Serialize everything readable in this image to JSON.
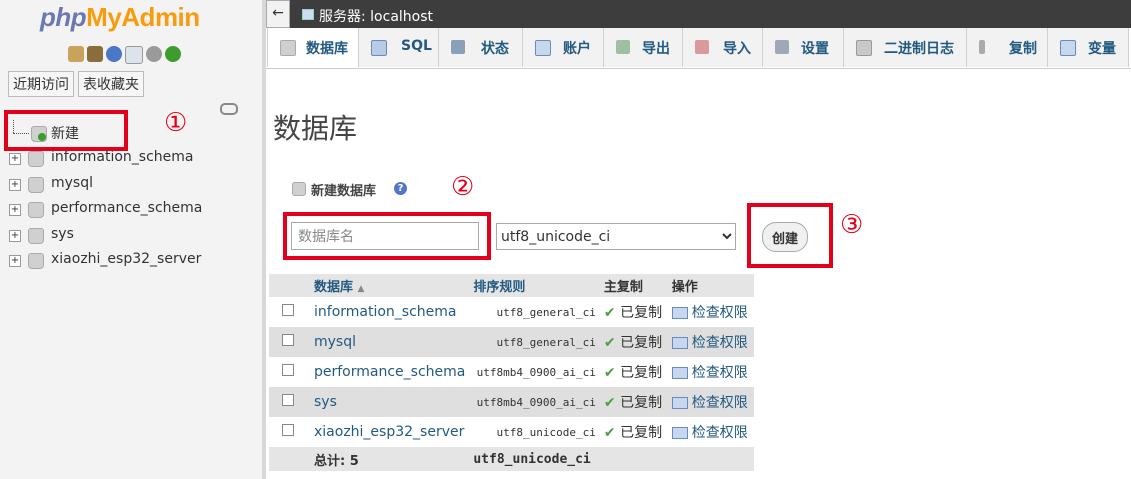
{
  "logo": {
    "php": "php",
    "my": "My",
    "admin": "Admin"
  },
  "sidebar": {
    "recent_tab": "近期访问",
    "favorites_tab": "表收藏夹",
    "new_label": "新建",
    "databases": [
      "information_schema",
      "mysql",
      "performance_schema",
      "sys",
      "xiaozhi_esp32_server"
    ]
  },
  "topbar": {
    "back": "←",
    "server": "服务器: localhost"
  },
  "tabs": [
    "数据库",
    "SQL",
    "状态",
    "账户",
    "导出",
    "导入",
    "设置",
    "二进制日志",
    "复制",
    "变量"
  ],
  "page_title": "数据库",
  "create": {
    "label": "新建数据库",
    "help": "?",
    "placeholder": "数据库名",
    "collation": "utf8_unicode_ci",
    "button": "创建"
  },
  "annotations": {
    "one": "①",
    "two": "②",
    "three": "③"
  },
  "table": {
    "headers": [
      "数据库",
      "排序规则",
      "主复制",
      "操作"
    ],
    "rows": [
      {
        "name": "information_schema",
        "collation": "utf8_general_ci",
        "replication": "已复制",
        "action": "检查权限"
      },
      {
        "name": "mysql",
        "collation": "utf8_general_ci",
        "replication": "已复制",
        "action": "检查权限"
      },
      {
        "name": "performance_schema",
        "collation": "utf8mb4_0900_ai_ci",
        "replication": "已复制",
        "action": "检查权限"
      },
      {
        "name": "sys",
        "collation": "utf8mb4_0900_ai_ci",
        "replication": "已复制",
        "action": "检查权限"
      },
      {
        "name": "xiaozhi_esp32_server",
        "collation": "utf8_unicode_ci",
        "replication": "已复制",
        "action": "检查权限"
      }
    ],
    "total_label": "总计: 5",
    "total_collation": "utf8_unicode_ci"
  }
}
